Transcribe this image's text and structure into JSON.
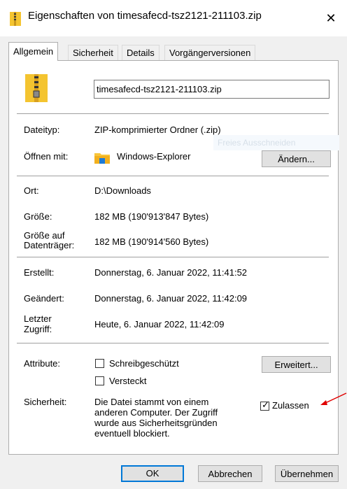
{
  "window": {
    "title": "Eigenschaften von timesafecd-tsz2121-211103.zip",
    "close_glyph": "✕"
  },
  "tabs": [
    {
      "label": "Allgemein",
      "active": true
    },
    {
      "label": "Sicherheit",
      "active": false
    },
    {
      "label": "Details",
      "active": false
    },
    {
      "label": "Vorgängerversionen",
      "active": false
    }
  ],
  "general": {
    "file_name": "timesafecd-tsz2121-211103.zip",
    "type_label": "Dateityp:",
    "type_value": "ZIP-komprimierter Ordner (.zip)",
    "open_with_label": "Öffnen mit:",
    "open_with_value": "Windows-Explorer",
    "change_button": "Ändern...",
    "tooltip_ghost": "Freies Ausschneiden",
    "location_label": "Ort:",
    "location_value": "D:\\Downloads",
    "size_label": "Größe:",
    "size_value": "182 MB (190'913'847 Bytes)",
    "size_on_disk_label_1": "Größe auf",
    "size_on_disk_label_2": "Datenträger:",
    "size_on_disk_value": "182 MB (190'914'560 Bytes)",
    "created_label": "Erstellt:",
    "created_value": "Donnerstag, 6. Januar 2022, 11:41:52",
    "modified_label": "Geändert:",
    "modified_value": "Donnerstag, 6. Januar 2022, 11:42:09",
    "accessed_label_1": "Letzter",
    "accessed_label_2": "Zugriff:",
    "accessed_value": "Heute, 6. Januar 2022, 11:42:09",
    "attributes_label": "Attribute:",
    "readonly_label": "Schreibgeschützt",
    "hidden_label": "Versteckt",
    "advanced_button": "Erweitert...",
    "security_label": "Sicherheit:",
    "security_text_1": "Die Datei stammt von einem",
    "security_text_2": "anderen Computer. Der Zugriff",
    "security_text_3": "wurde aus Sicherheitsgründen",
    "security_text_4": "eventuell blockiert.",
    "unblock_label": "Zulassen",
    "unblock_checked": true,
    "readonly_checked": false,
    "hidden_checked": false
  },
  "footer": {
    "ok": "OK",
    "cancel": "Abbrechen",
    "apply": "Übernehmen"
  },
  "colors": {
    "accent": "#0078d7",
    "annotation_arrow": "#e00000",
    "zip_icon": "#f4c430"
  }
}
